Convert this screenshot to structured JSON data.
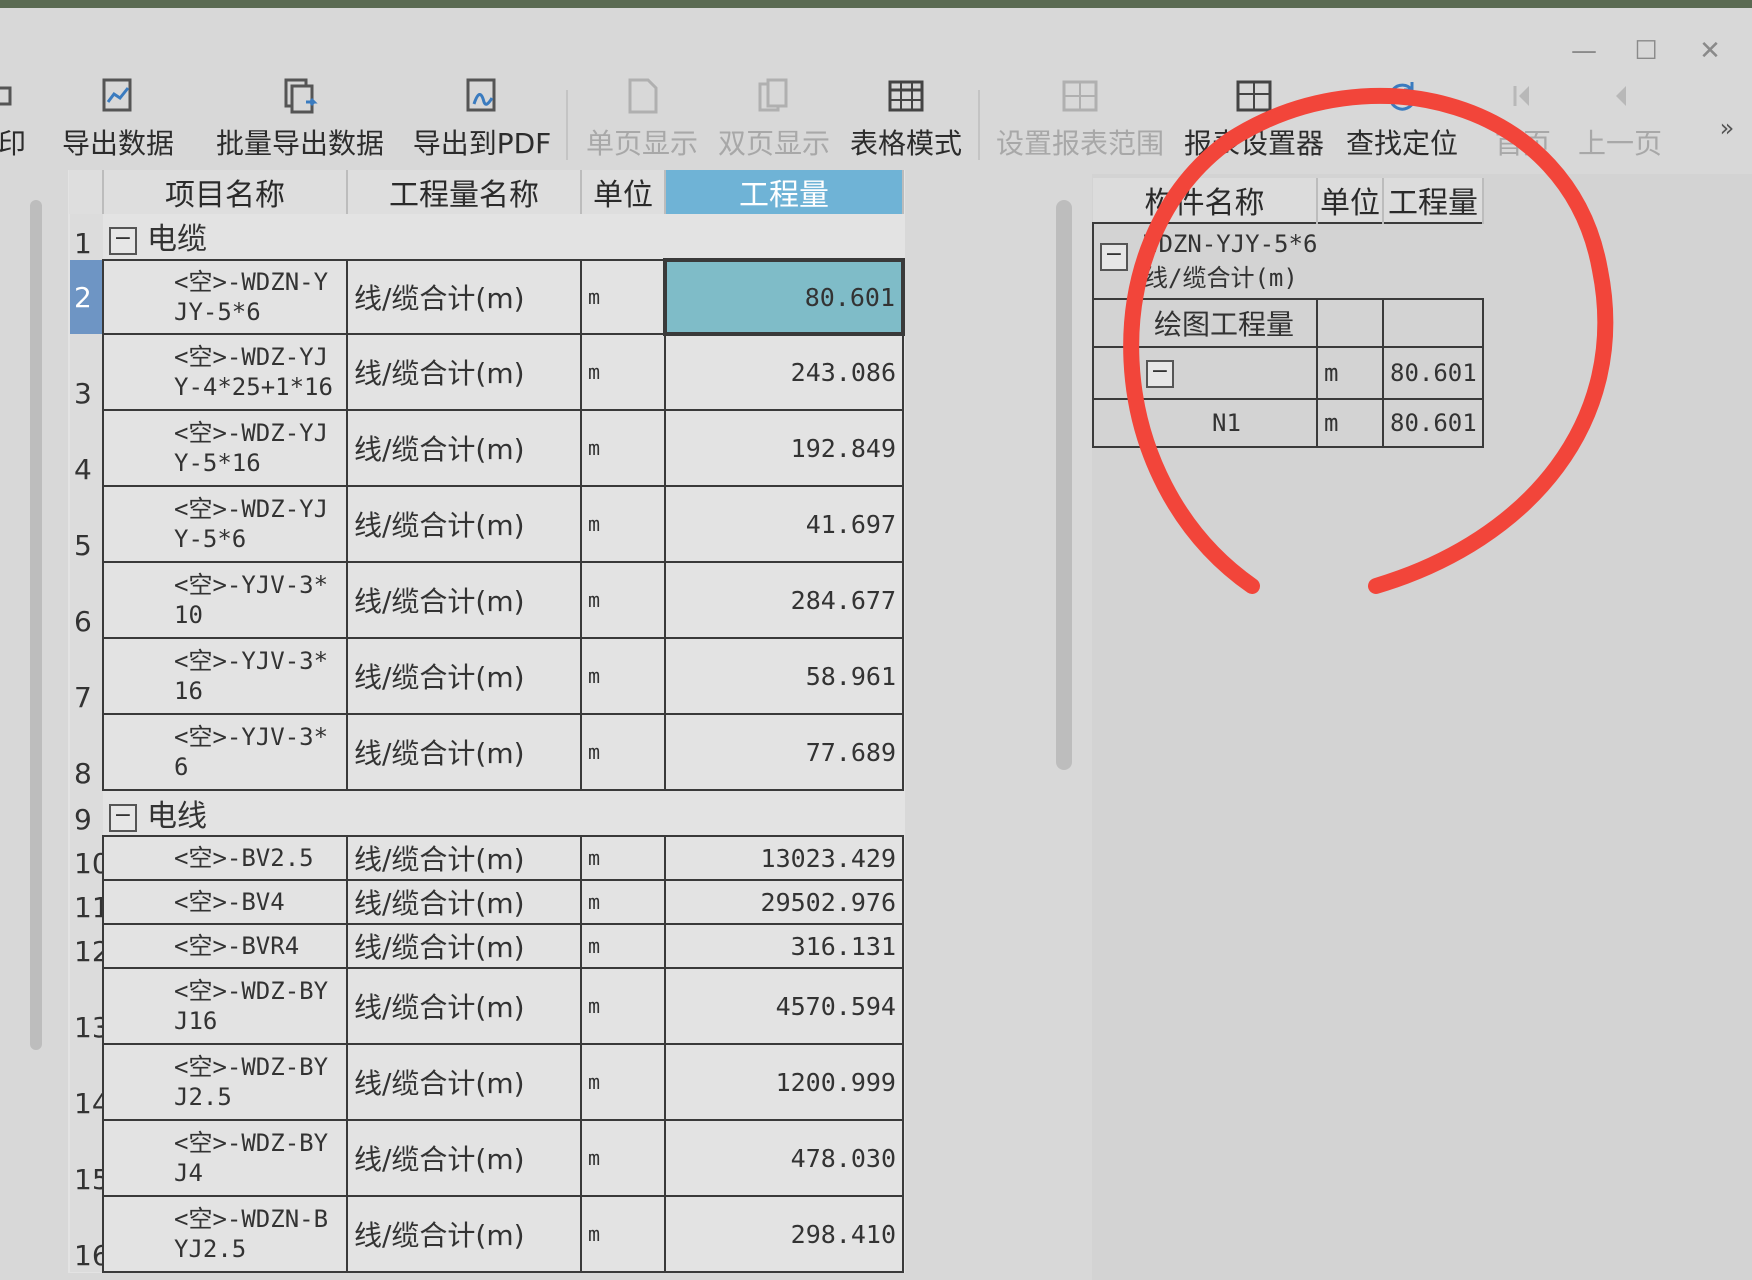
{
  "window": {
    "minimize_glyph": "—",
    "maximize_glyph": "☐",
    "close_glyph": "✕"
  },
  "toolbar": {
    "partial_left_label": "印",
    "export_data": "导出数据",
    "batch_export": "批量导出数据",
    "export_pdf": "导出到PDF",
    "single_page": "单页显示",
    "double_page": "双页显示",
    "table_mode": "表格模式",
    "set_range": "设置报表范围",
    "report_settings": "报表设置器",
    "find_locate": "查找定位",
    "first_page": "首页",
    "prev_page": "上一页",
    "overflow": "»"
  },
  "grid": {
    "headers": [
      "项目名称",
      "工程量名称",
      "单位",
      "工程量"
    ],
    "rows": [
      {
        "num": "1",
        "group": "电缆"
      },
      {
        "num": "2",
        "name1": "<空>-WDZN-Y",
        "name2": "JY-5*6",
        "qname": "线/缆合计(m)",
        "unit": "m",
        "qty": "80.601"
      },
      {
        "num": "3",
        "name1": "<空>-WDZ-YJ",
        "name2": "Y-4*25+1*16",
        "qname": "线/缆合计(m)",
        "unit": "m",
        "qty": "243.086"
      },
      {
        "num": "4",
        "name1": "<空>-WDZ-YJ",
        "name2": "Y-5*16",
        "qname": "线/缆合计(m)",
        "unit": "m",
        "qty": "192.849"
      },
      {
        "num": "5",
        "name1": "<空>-WDZ-YJ",
        "name2": "Y-5*6",
        "qname": "线/缆合计(m)",
        "unit": "m",
        "qty": "41.697"
      },
      {
        "num": "6",
        "name1": "<空>-YJV-3*",
        "name2": "10",
        "qname": "线/缆合计(m)",
        "unit": "m",
        "qty": "284.677"
      },
      {
        "num": "7",
        "name1": "<空>-YJV-3*",
        "name2": "16",
        "qname": "线/缆合计(m)",
        "unit": "m",
        "qty": "58.961"
      },
      {
        "num": "8",
        "name1": "<空>-YJV-3*",
        "name2": "6",
        "qname": "线/缆合计(m)",
        "unit": "m",
        "qty": "77.689"
      },
      {
        "num": "9",
        "group": "电线"
      },
      {
        "num": "10",
        "name1": "<空>-BV2.5",
        "qname": "线/缆合计(m)",
        "unit": "m",
        "qty": "13023.429"
      },
      {
        "num": "11",
        "name1": "<空>-BV4",
        "qname": "线/缆合计(m)",
        "unit": "m",
        "qty": "29502.976"
      },
      {
        "num": "12",
        "name1": "<空>-BVR4",
        "qname": "线/缆合计(m)",
        "unit": "m",
        "qty": "316.131"
      },
      {
        "num": "13",
        "name1": "<空>-WDZ-BY",
        "name2": "J16",
        "qname": "线/缆合计(m)",
        "unit": "m",
        "qty": "4570.594"
      },
      {
        "num": "14",
        "name1": "<空>-WDZ-BY",
        "name2": "J2.5",
        "qname": "线/缆合计(m)",
        "unit": "m",
        "qty": "1200.999"
      },
      {
        "num": "15",
        "name1": "<空>-WDZ-BY",
        "name2": "J4",
        "qname": "线/缆合计(m)",
        "unit": "m",
        "qty": "478.030"
      },
      {
        "num": "16",
        "name1": "<空>-WDZN-B",
        "name2": "YJ2.5",
        "qname": "线/缆合计(m)",
        "unit": "m",
        "qty": "298.410"
      }
    ]
  },
  "right_panel": {
    "headers": [
      "构件名称",
      "单位",
      "工程量"
    ],
    "item_line1": "WDZN-YJY-5*6",
    "item_line2": "线/缆合计(m)",
    "section": "绘图工程量",
    "sub_unit": "m",
    "sub_qty": "80.601",
    "leaf_name": "N1",
    "leaf_unit": "m",
    "leaf_qty": "80.601"
  },
  "annotation": {
    "color": "#f2453a"
  }
}
